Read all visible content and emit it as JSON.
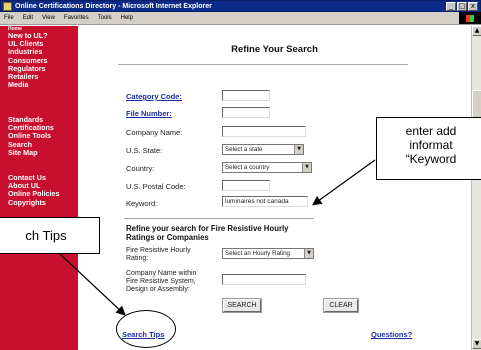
{
  "window": {
    "title": "Online Certifications Directory - Microsoft Internet Explorer",
    "buttons": [
      "_",
      "□",
      "x"
    ]
  },
  "menu": [
    "File",
    "Edit",
    "View",
    "Favorites",
    "Tools",
    "Help"
  ],
  "leftnav": {
    "group1": [
      "Home",
      "New to UL?",
      "UL Clients",
      "Industries",
      "Consumers",
      "Regulators",
      "Retailers",
      "Media"
    ],
    "group2": [
      "Standards",
      "Certifications",
      "Online Tools",
      "Search",
      "Site Map"
    ],
    "group3": [
      "Contact Us",
      "About UL",
      "Online Policies",
      "Copyrights"
    ]
  },
  "form": {
    "title": "Refine Your Search",
    "category_code": "Category Code:",
    "file_number": "File Number:",
    "company_name": "Company Name:",
    "us_state": "U.S. State:",
    "state_select": "Select a state",
    "country": "Country:",
    "country_select": "Select a country",
    "postal_code": "U.S. Postal Code:",
    "keyword": "Keyword:",
    "keyword_value": "luminaires not canada",
    "refine_title_1": "Refine your search for Fire Resistive Hourly",
    "refine_title_2": "Ratings or Companies",
    "hourly_label_1": "Fire Resistive Hourly",
    "hourly_label_2": "Rating:",
    "hourly_select": "Select an Hourly Rating",
    "company_within_1": "Company Name within",
    "company_within_2": "Fire Resistive System,",
    "company_within_3": "Design or Assembly:",
    "search_button": "SEARCH",
    "clear_button": "CLEAR",
    "search_tips": "Search Tips",
    "questions": "Questions?"
  },
  "callouts": {
    "right_line1": "enter add",
    "right_line2": "informat",
    "right_line3": "“Keyword",
    "left": "ch Tips"
  },
  "colors": {
    "nav_red": "#c8102e",
    "link_blue": "#1a2fa6",
    "titlebar": "#0b2a8a"
  }
}
